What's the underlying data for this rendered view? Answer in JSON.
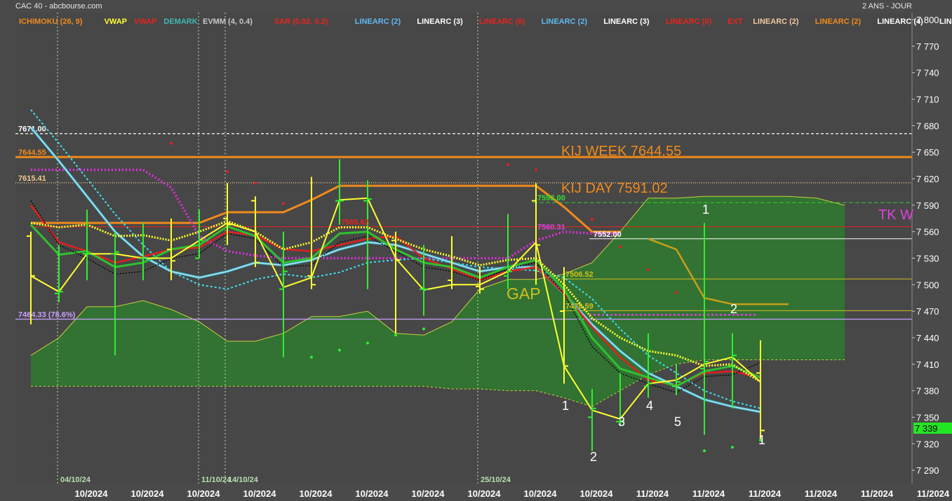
{
  "header": {
    "title": "CAC 40 - abcbourse.com",
    "period": "2 ANS - JOUR"
  },
  "indicators": [
    {
      "label": "ICHIMOKU (26, 9)",
      "color": "#f08a1c"
    },
    {
      "label": "VWAP",
      "color": "#ffff33"
    },
    {
      "label": "VWAP",
      "color": "#e8241c"
    },
    {
      "label": "DEMARK",
      "color": "#3fb8b0"
    },
    {
      "label": "EVMM (4, 0.4)",
      "color": "#c8c8c8"
    },
    {
      "label": "SAR (0.02, 0.2)",
      "color": "#e8241c"
    },
    {
      "label": "LINEARC (2)",
      "color": "#60b8f0"
    },
    {
      "label": "LINEARC (3)",
      "color": "#ffffff"
    },
    {
      "label": "LINEARC (0)",
      "color": "#e8241c"
    },
    {
      "label": "LINEARC (2)",
      "color": "#60b8f0"
    },
    {
      "label": "LINEARC (3)",
      "color": "#ffffff"
    },
    {
      "label": "LINEARC (0)",
      "color": "#e8241c"
    },
    {
      "label": "EXT",
      "color": "#e8241c"
    },
    {
      "label": "LINEARC (2)",
      "color": "#f0c8a0"
    },
    {
      "label": "LINEARC (2)",
      "color": "#f08a1c"
    },
    {
      "label": "LINEARC (4)",
      "color": "#ffffff"
    },
    {
      "label": "LINEARC",
      "color": "#ffffff"
    }
  ],
  "chart_data": {
    "type": "candlestick",
    "y_ticks": [
      7290,
      7320,
      7350,
      7380,
      7410,
      7440,
      7470,
      7500,
      7530,
      7560,
      7590,
      7620,
      7650,
      7680,
      7710,
      7740,
      7770,
      7800
    ],
    "y_tick_labels": [
      "7 290",
      "7 320",
      "7 350",
      "7 380",
      "7 410",
      "7 440",
      "7 470",
      "7 500",
      "7 530",
      "7 560",
      "7 590",
      "7 620",
      "7 650",
      "7 680",
      "7 710",
      "7 740",
      "7 770",
      "7 800"
    ],
    "ylim": [
      7275,
      7808
    ],
    "x_tick_labels": [
      "10/2024",
      "10/2024",
      "10/2024",
      "10/2024",
      "10/2024",
      "10/2024",
      "10/2024",
      "10/2024",
      "10/2024",
      "10/2024",
      "11/2024",
      "11/2024",
      "11/2024",
      "11/2024",
      "11/2024",
      "11/2024"
    ],
    "date_markers": [
      "04/10/24",
      "11/10/24",
      "14/10/24",
      "25/10/24"
    ],
    "last_price": "7 339",
    "price_bars": [
      {
        "o": 7555,
        "h": 7560,
        "l": 7455,
        "c": 7510
      },
      {
        "o": 7490,
        "h": 7545,
        "l": 7480,
        "c": 7492
      },
      {
        "o": 7535,
        "h": 7585,
        "l": 7505,
        "c": 7535
      },
      {
        "o": 7535,
        "h": 7560,
        "l": 7420,
        "c": 7537
      },
      {
        "o": 7530,
        "h": 7570,
        "l": 7505,
        "c": 7530
      },
      {
        "o": 7540,
        "h": 7575,
        "l": 7505,
        "c": 7527
      },
      {
        "o": 7530,
        "h": 7585,
        "l": 7530,
        "c": 7550
      },
      {
        "o": 7575,
        "h": 7615,
        "l": 7545,
        "c": 7568
      },
      {
        "o": 7595,
        "h": 7600,
        "l": 7520,
        "c": 7525
      },
      {
        "o": 7495,
        "h": 7560,
        "l": 7418,
        "c": 7515
      },
      {
        "o": 7510,
        "h": 7622,
        "l": 7495,
        "c": 7500
      },
      {
        "o": 7595,
        "h": 7642,
        "l": 7568,
        "c": 7595
      },
      {
        "o": 7595,
        "h": 7618,
        "l": 7495,
        "c": 7597
      },
      {
        "o": 7550,
        "h": 7560,
        "l": 7445,
        "c": 7528
      },
      {
        "o": 7495,
        "h": 7545,
        "l": 7465,
        "c": 7495
      },
      {
        "o": 7505,
        "h": 7555,
        "l": 7495,
        "c": 7500
      },
      {
        "o": 7498,
        "h": 7520,
        "l": 7490,
        "c": 7495
      },
      {
        "o": 7510,
        "h": 7580,
        "l": 7495,
        "c": 7515
      },
      {
        "o": 7595,
        "h": 7615,
        "l": 7500,
        "c": 7545
      },
      {
        "o": 7470,
        "h": 7520,
        "l": 7388,
        "c": 7408
      },
      {
        "o": 7350,
        "h": 7382,
        "l": 7312,
        "c": 7360
      },
      {
        "o": 7345,
        "h": 7400,
        "l": 7340,
        "c": 7345
      },
      {
        "o": 7385,
        "h": 7445,
        "l": 7372,
        "c": 7388
      },
      {
        "o": 7385,
        "h": 7410,
        "l": 7375,
        "c": 7390
      },
      {
        "o": 7405,
        "h": 7570,
        "l": 7330,
        "c": 7413
      },
      {
        "o": 7408,
        "h": 7445,
        "l": 7360,
        "c": 7420
      },
      {
        "o": 7400,
        "h": 7437,
        "l": 7325,
        "c": 7335
      }
    ],
    "levels": [
      {
        "label": "7671.00",
        "value": 7671,
        "color": "#ffffff",
        "style": "dashed"
      },
      {
        "label": "7644.55",
        "value": 7644.55,
        "color": "#f08a1c",
        "style": "solid"
      },
      {
        "label": "7615.41",
        "value": 7615.41,
        "color": "#f0c890",
        "style": "dotted"
      },
      {
        "label": "7464.33  (78.6%)",
        "value": 7461,
        "color": "#c8a0ff",
        "style": "solid"
      }
    ],
    "annotations": [
      {
        "text": "KIJ WEEK 7644.55",
        "color": "#f08a1c"
      },
      {
        "text": "KIJ DAY 7591.02",
        "color": "#f08a1c"
      },
      {
        "text": "GAP",
        "color": "#d0c020"
      },
      {
        "text": "TK W",
        "color": "#e040e0"
      }
    ],
    "level_labels": [
      {
        "text": "7593.00",
        "value": 7593,
        "color": "#30e030"
      },
      {
        "text": "7560.31",
        "value": 7560.31,
        "color": "#e040e0"
      },
      {
        "text": "7552.00",
        "value": 7552,
        "color": "#ffffff"
      },
      {
        "text": "7506.52",
        "value": 7506.52,
        "color": "#d0c020"
      },
      {
        "text": "7470.59",
        "value": 7470.59,
        "color": "#d0c020"
      },
      {
        "text": "7565.62",
        "value": 7565.62,
        "color": "#e8241c"
      }
    ],
    "wave_labels": [
      "1",
      "2",
      "3",
      "4",
      "5",
      "1",
      "2",
      "1"
    ]
  }
}
